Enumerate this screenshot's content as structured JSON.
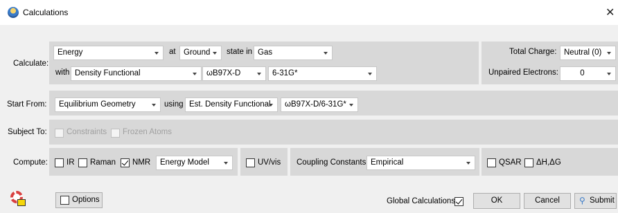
{
  "window": {
    "title": "Calculations",
    "close_glyph": "✕"
  },
  "calculate": {
    "label": "Calculate:",
    "type": "Energy",
    "at": "at",
    "state": "Ground",
    "state_in": "state in",
    "medium": "Gas",
    "with": "with",
    "method": "Density Functional",
    "functional": "ωB97X-D",
    "basis": "6-31G*",
    "total_charge_label": "Total Charge:",
    "total_charge": "Neutral (0)",
    "unpaired_label": "Unpaired Electrons:",
    "unpaired": "0"
  },
  "start_from": {
    "label": "Start From:",
    "geometry": "Equilibrium Geometry",
    "using": "using",
    "method": "Est. Density Functional",
    "level": "ωB97X-D/6-31G*"
  },
  "subject_to": {
    "label": "Subject To:",
    "constraints": "Constraints",
    "frozen_atoms": "Frozen Atoms"
  },
  "compute": {
    "label": "Compute:",
    "ir": "IR",
    "raman": "Raman",
    "nmr": "NMR",
    "nmr_checked": true,
    "model": "Energy Model",
    "uvvis": "UV/vis",
    "coupling_label": "Coupling Constants:",
    "coupling": "Empirical",
    "qsar": "QSAR",
    "dhdg": "ΔH,ΔG"
  },
  "footer": {
    "options": "Options",
    "global_label": "Global Calculations",
    "global_checked": true,
    "ok": "OK",
    "cancel": "Cancel",
    "submit": "Submit"
  }
}
